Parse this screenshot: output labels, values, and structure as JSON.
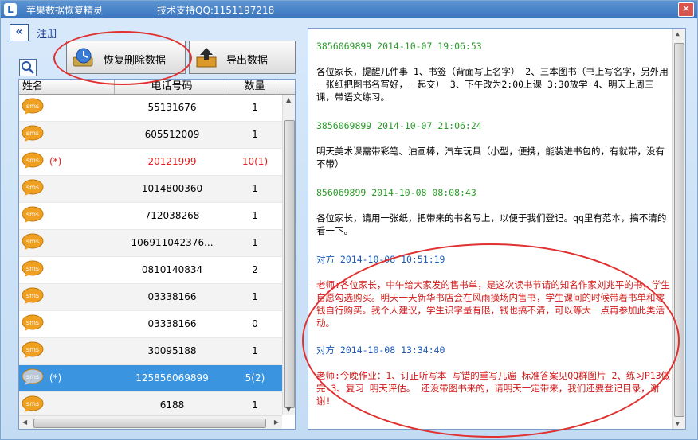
{
  "window": {
    "title": "苹果数据恢复精灵",
    "support": "技术支持QQ:1151197218",
    "close_symbol": "✕"
  },
  "nav": {
    "back_symbol": "«",
    "register": "注册"
  },
  "toolbar": {
    "recover_label": "恢复删除数据",
    "export_label": "导出数据"
  },
  "table": {
    "columns": [
      "姓名",
      "电话号码",
      "数量"
    ],
    "rows": [
      {
        "mark": "",
        "phone": "55131676",
        "count": "1"
      },
      {
        "mark": "",
        "phone": "605512009",
        "count": "1"
      },
      {
        "mark": "(*)",
        "phone": "20121999",
        "count": "10(1)"
      },
      {
        "mark": "",
        "phone": "1014800360",
        "count": "1"
      },
      {
        "mark": "",
        "phone": "712038268",
        "count": "1"
      },
      {
        "mark": "",
        "phone": "106911042376...",
        "count": "1"
      },
      {
        "mark": "",
        "phone": "0810140834",
        "count": "2"
      },
      {
        "mark": "",
        "phone": "03338166",
        "count": "1"
      },
      {
        "mark": "",
        "phone": "03338166",
        "count": "0"
      },
      {
        "mark": "",
        "phone": "30095188",
        "count": "1"
      },
      {
        "mark": "(*)",
        "phone": "125856069899",
        "count": "5(2)"
      },
      {
        "mark": "",
        "phone": "6188",
        "count": "1"
      }
    ]
  },
  "messages": [
    {
      "header": "3856069899  2014-10-07  19:06:53",
      "body": "各位家长，提醒几件事 1、书签（背面写上名字） 2、三本图书（书上写名字，另外用一张纸把图书名写好，一起交） 3、下午改为2:00上课 3:30放学 4、明天上周三课，带语文练习。"
    },
    {
      "header": "3856069899  2014-10-07  21:06:24",
      "body": "明天美术课需带彩笔、油画棒，汽车玩具（小型，便携，能装进书包的，有就带，没有不带）"
    },
    {
      "header": "856069899  2014-10-08  08:08:43",
      "body": "各位家长，请用一张纸，把带来的书名写上，以便于我们登记。qq里有范本，搞不清的看一下。"
    },
    {
      "header": "对方  2014-10-08  10:51:19",
      "body": "老师:各位家长，中午给大家发的售书单，是这次读书节请的知名作家刘兆平的书，学生自愿勾选购买。明天一天新华书店会在风雨操场内售书，学生课间的时候带着书单和零钱自行购买。我个人建议，学生识字量有限，钱也搞不清，可以等大一点再参加此类活动。"
    },
    {
      "header": "对方  2014-10-08  13:34:40",
      "body": "老师:今晚作业：1、订正听写本 写错的重写几遍 标准答案见QQ群图片 2、练习P13做完 3、复习 明天评估。 还没带图书来的，请明天一定带来，我们还要登记目录，谢谢!"
    }
  ]
}
